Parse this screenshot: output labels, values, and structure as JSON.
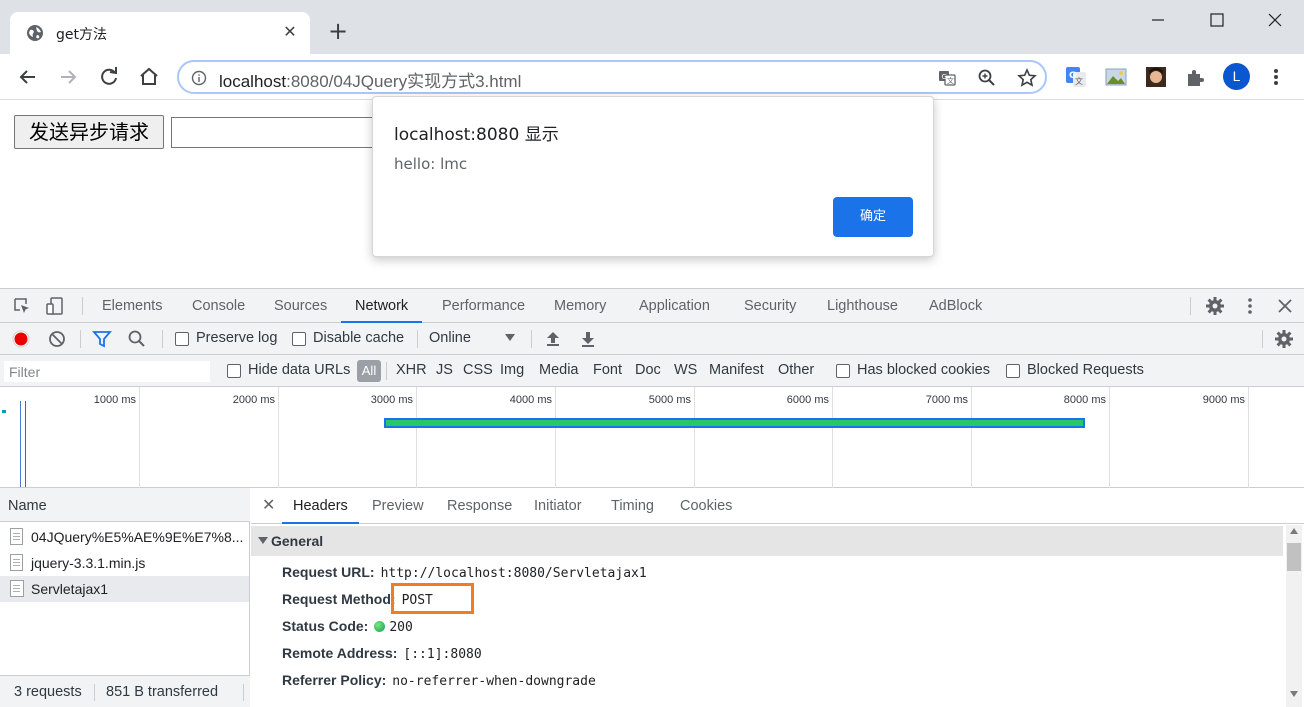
{
  "browser": {
    "tab_title": "get方法",
    "tab_close": "✕",
    "new_tab": "+",
    "url_host": "localhost",
    "url_rest": ":8080/04JQuery实现方式3.html",
    "avatar_letter": "L",
    "accent_color": "#1a73e8"
  },
  "page": {
    "button_label": "发送异步请求",
    "input_value": ""
  },
  "dialog": {
    "title": "localhost:8080 显示",
    "message": "hello: lmc",
    "ok_label": "确定"
  },
  "devtools": {
    "tabs": [
      "Elements",
      "Console",
      "Sources",
      "Network",
      "Performance",
      "Memory",
      "Application",
      "Security",
      "Lighthouse",
      "AdBlock"
    ],
    "active_tab": "Network",
    "network_toolbar": {
      "preserve_log": "Preserve log",
      "disable_cache": "Disable cache",
      "throttle": "Online"
    },
    "filter": {
      "placeholder": "Filter",
      "hide_data_urls": "Hide data URLs",
      "all": "All",
      "types": [
        "XHR",
        "JS",
        "CSS",
        "Img",
        "Media",
        "Font",
        "Doc",
        "WS",
        "Manifest",
        "Other"
      ],
      "has_blocked_cookies": "Has blocked cookies",
      "blocked_requests": "Blocked Requests"
    },
    "overview": {
      "ticks": [
        "1000 ms",
        "2000 ms",
        "3000 ms",
        "4000 ms",
        "5000 ms",
        "6000 ms",
        "7000 ms",
        "8000 ms",
        "9000 ms"
      ],
      "bar_color": "#27c767"
    },
    "requests": {
      "header": "Name",
      "items": [
        "04JQuery%E5%AE%9E%E7%8...",
        "jquery-3.3.1.min.js",
        "Servletajax1"
      ],
      "selected": "Servletajax1",
      "summary_requests": "3 requests",
      "summary_transferred": "851 B transferred"
    },
    "detail": {
      "close": "✕",
      "tabs": [
        "Headers",
        "Preview",
        "Response",
        "Initiator",
        "Timing",
        "Cookies"
      ],
      "active_tab": "Headers",
      "section": "General",
      "rows": [
        {
          "key": "Request URL:",
          "value": "http://localhost:8080/Servletajax1"
        },
        {
          "key": "Request Method:",
          "value": "POST"
        },
        {
          "key": "Status Code:",
          "value": "200"
        },
        {
          "key": "Remote Address:",
          "value": "[::1]:8080"
        },
        {
          "key": "Referrer Policy:",
          "value": "no-referrer-when-downgrade"
        }
      ],
      "highlight_color": "#f07d22"
    }
  }
}
